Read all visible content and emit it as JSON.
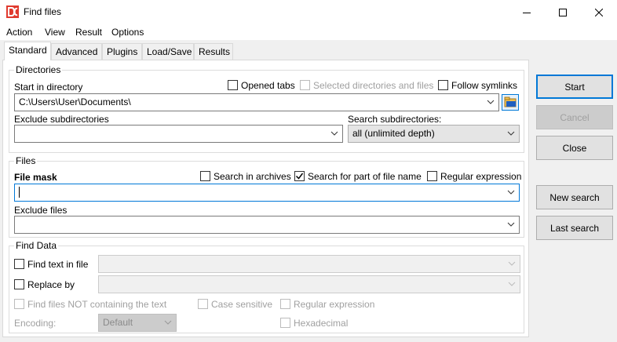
{
  "window": {
    "title": "Find files",
    "minimize_icon": "minimize-icon",
    "maximize_icon": "maximize-icon",
    "close_icon": "close-icon"
  },
  "menu": [
    "Action",
    "View",
    "Result",
    "Options"
  ],
  "tabs": [
    "Standard",
    "Advanced",
    "Plugins",
    "Load/Save",
    "Results"
  ],
  "directories": {
    "title": "Directories",
    "start_label": "Start in directory",
    "opened_tabs": "Opened tabs",
    "selected_dirs": "Selected directories and files",
    "follow_symlinks": "Follow symlinks",
    "start_value": "C:\\Users\\User\\Documents\\",
    "exclude_label": "Exclude subdirectories",
    "exclude_value": "",
    "search_subdirs_label": "Search subdirectories:",
    "search_subdirs_value": "all (unlimited depth)"
  },
  "files": {
    "title": "Files",
    "mask_label": "File mask",
    "search_archives": "Search in archives",
    "search_part": "Search for part of file name",
    "regular_expression": "Regular expression",
    "mask_value": "",
    "exclude_label": "Exclude files",
    "exclude_value": ""
  },
  "find_data": {
    "title": "Find Data",
    "find_text": "Find text in file",
    "replace_by": "Replace by",
    "not_containing": "Find files NOT containing the text",
    "case_sensitive": "Case sensitive",
    "regular_expression": "Regular expression",
    "encoding_label": "Encoding:",
    "encoding_value": "Default",
    "hexadecimal": "Hexadecimal"
  },
  "buttons": {
    "start": "Start",
    "cancel": "Cancel",
    "close": "Close",
    "new_search": "New search",
    "last_search": "Last search"
  },
  "colors": {
    "accent": "#0078d7",
    "icon_red": "#e03a2e"
  }
}
